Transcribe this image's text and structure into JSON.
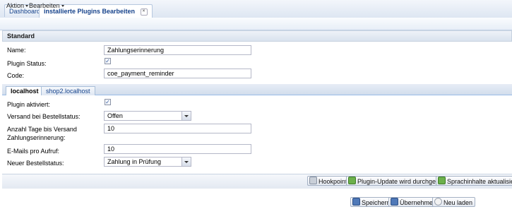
{
  "tabs": {
    "dashboard": "Dashboard",
    "active": "installierte Plugins Bearbeiten",
    "close_glyph": "×"
  },
  "menu": {
    "aktion": "Aktion",
    "bearbeiten": "Bearbeiten"
  },
  "standard": {
    "title": "Standard",
    "name_label": "Name:",
    "name_value": "Zahlungserinnerung",
    "status_label": "Plugin Status:",
    "status_checked": true,
    "code_label": "Code:",
    "code_value": "coe_payment_reminder"
  },
  "hosts": {
    "tabs": [
      "localhost",
      "shop2.localhost"
    ],
    "active_index": 0
  },
  "host_form": {
    "activated_label": "Plugin aktiviert:",
    "activated_checked": true,
    "versand_label": "Versand bei Bestellstatus:",
    "versand_value": "Offen",
    "tage_label_line1": "Anzahl Tage bis Versand",
    "tage_label_line2": "Zahlungserinnerung:",
    "tage_value": "10",
    "emails_label": "E-Mails pro Aufruf:",
    "emails_value": "10",
    "neuer_label": "Neuer Bestellstatus:",
    "neuer_value": "Zahlung in Prüfung"
  },
  "toolbar": {
    "hookpoints": "Hookpoints",
    "plugin_update": "Plugin-Update wird durchgeführt",
    "sprachinhalte": "Sprachinhalte aktualisieren"
  },
  "footer": {
    "speichern": "Speichern",
    "uebernehmen": "Übernehmen",
    "neu_laden": "Neu laden"
  },
  "colors": {
    "accent": "#15428b",
    "tab_border": "#99bbe8",
    "checkmark": "#3a5fa0"
  }
}
